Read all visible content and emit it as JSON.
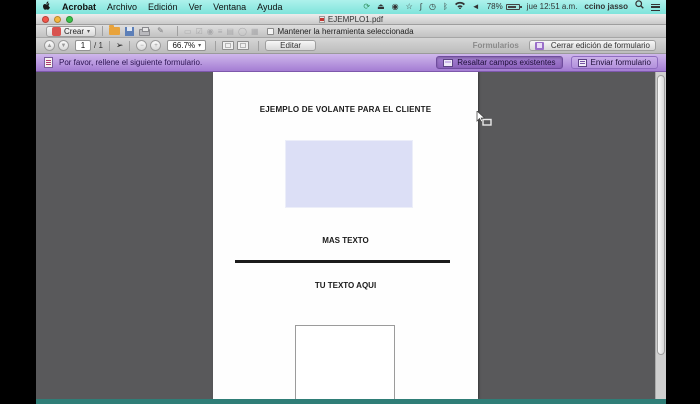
{
  "menubar": {
    "items": [
      "Acrobat",
      "Archivo",
      "Edición",
      "Ver",
      "Ventana",
      "Ayuda"
    ],
    "status": {
      "battery": "78%",
      "clock": "jue 12:51 a.m.",
      "user": "ccino jasso"
    },
    "status_icon_glyphs": {
      "sync": "⟳",
      "eject": "⏏",
      "user": "◉",
      "star": "☆",
      "key": "∫",
      "clock": "◷",
      "bluetooth": "ᛒ",
      "volume": "◄"
    }
  },
  "titlebar": {
    "title": "EJEMPLO1.pdf"
  },
  "toolbar": {
    "crear": "Crear",
    "dropdown_glyph": "▾",
    "edit_glyph": "✎",
    "keep_tool": "Mantener la herramienta seleccionada",
    "disabled_glyphs": {
      "textfield": "▭",
      "checkbox": "☑",
      "radio": "◉",
      "list": "≡",
      "dropdown": "▤",
      "button": "◯",
      "signature": "▦"
    }
  },
  "navbar": {
    "prev_glyph": "▲",
    "next_glyph": "▼",
    "page": "1",
    "page_total": "/ 1",
    "pointer_glyph": "➢",
    "zoom_out_glyph": "−",
    "zoom_in_glyph": "+",
    "zoom": "66.7%",
    "zoom_dropdown_glyph": "▾",
    "editar": "Editar",
    "formularios": "Formularios",
    "cerrar": "Cerrar edición de formulario"
  },
  "formbar": {
    "message": "Por favor, rellene el siguiente formulario.",
    "resaltar": "Resaltar campos existentes",
    "enviar": "Enviar formulario"
  },
  "page": {
    "title": "EJEMPLO DE VOLANTE PARA EL CLIENTE",
    "mas_texto": "MAS TEXTO",
    "tu_texto": "TU TEXTO AQUI"
  },
  "colors": {
    "menubar_teal": "#8ceae2",
    "accent_purple": "#a47dd3",
    "field_lavender": "#dcdff6",
    "doc_grey": "#59595b",
    "teal_strip": "#2f7e77",
    "letterbox": "#000000"
  }
}
